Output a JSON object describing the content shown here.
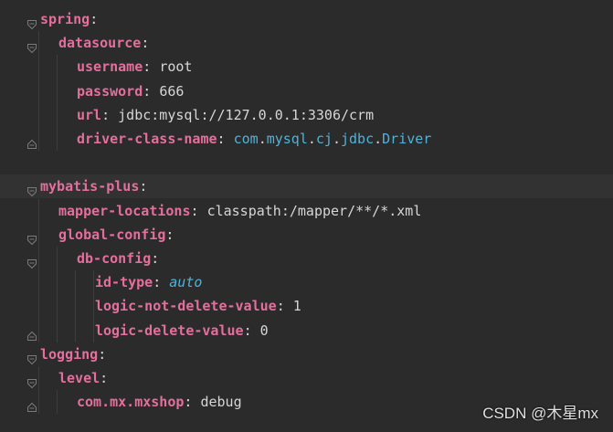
{
  "editor": {
    "lines": [
      {
        "indent": 0,
        "key": "spring",
        "fold": "open"
      },
      {
        "indent": 1,
        "key": "datasource",
        "fold": "open"
      },
      {
        "indent": 2,
        "key": "username",
        "value": "root"
      },
      {
        "indent": 2,
        "key": "password",
        "value": "666"
      },
      {
        "indent": 2,
        "key": "url",
        "value": "jdbc:mysql://127.0.0.1:3306/crm"
      },
      {
        "indent": 2,
        "key": "driver-class-name",
        "value": "com.mysql.cj.jdbc.Driver",
        "value_style": "package",
        "fold": "close"
      },
      {
        "blank": true
      },
      {
        "indent": 0,
        "key": "mybatis-plus",
        "fold": "open",
        "current": true
      },
      {
        "indent": 1,
        "key": "mapper-locations",
        "value": "classpath:/mapper/**/*.xml"
      },
      {
        "indent": 1,
        "key": "global-config",
        "fold": "open"
      },
      {
        "indent": 2,
        "key": "db-config",
        "fold": "open"
      },
      {
        "indent": 3,
        "key": "id-type",
        "value": "auto",
        "value_style": "italic"
      },
      {
        "indent": 3,
        "key": "logic-not-delete-value",
        "value": "1"
      },
      {
        "indent": 3,
        "key": "logic-delete-value",
        "value": "0",
        "fold": "close"
      },
      {
        "indent": 0,
        "key": "logging",
        "fold": "open"
      },
      {
        "indent": 1,
        "key": "level",
        "fold": "open"
      },
      {
        "indent": 2,
        "key": "com.mx.mxshop",
        "value": "debug",
        "fold": "close"
      }
    ]
  },
  "watermark": "CSDN @木星mx",
  "colors": {
    "background": "#2b2b2b",
    "key": "#e46f9c",
    "plain": "#d6d6d6",
    "package": "#4fb3d9"
  }
}
